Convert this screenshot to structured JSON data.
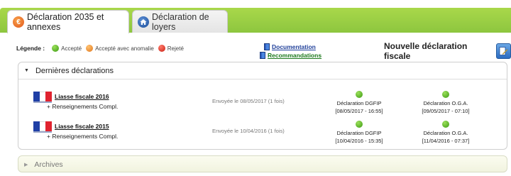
{
  "tabs": [
    {
      "label": "Déclaration 2035 et annexes",
      "icon": "euro-icon",
      "active": true
    },
    {
      "label": "Déclaration de loyers",
      "icon": "house-icon",
      "active": false
    }
  ],
  "legend": {
    "title": "Légende :",
    "items": [
      {
        "label": "Accepté",
        "color": "#3c9a12"
      },
      {
        "label": "Accepté avec anomalie",
        "color": "#e0771d"
      },
      {
        "label": "Rejeté",
        "color": "#c81e12"
      }
    ]
  },
  "links": {
    "documentation": "Documentation",
    "recommandations": "Recommandations"
  },
  "new_declaration": {
    "label": "Nouvelle déclaration fiscale",
    "icon": "new-document-icon"
  },
  "last_declarations": {
    "title": "Dernières déclarations",
    "rows": [
      {
        "liasse": "Liasse fiscale 2016",
        "extra": "+ Renseignements Compl.",
        "sent": "Envoyée le 08/05/2017 (1 fois)",
        "dgfip_label": "Déclaration DGFIP",
        "dgfip_date": "[08/05/2017 - 16:55]",
        "oga_label": "Déclaration O.G.A.",
        "oga_date": "[09/05/2017 - 07:10]"
      },
      {
        "liasse": "Liasse fiscale 2015",
        "extra": "+ Renseignements Compl.",
        "sent": "Envoyée le 10/04/2016 (1 fois)",
        "dgfip_label": "Déclaration DGFIP",
        "dgfip_date": "[10/04/2016 - 15:35]",
        "oga_label": "Déclaration O.G.A.",
        "oga_date": "[11/04/2016 - 07:37]"
      }
    ]
  },
  "archives": {
    "title": "Archives"
  },
  "colors": {
    "accent_green": "#8dc63f",
    "status_ok": "#3c9a12"
  }
}
